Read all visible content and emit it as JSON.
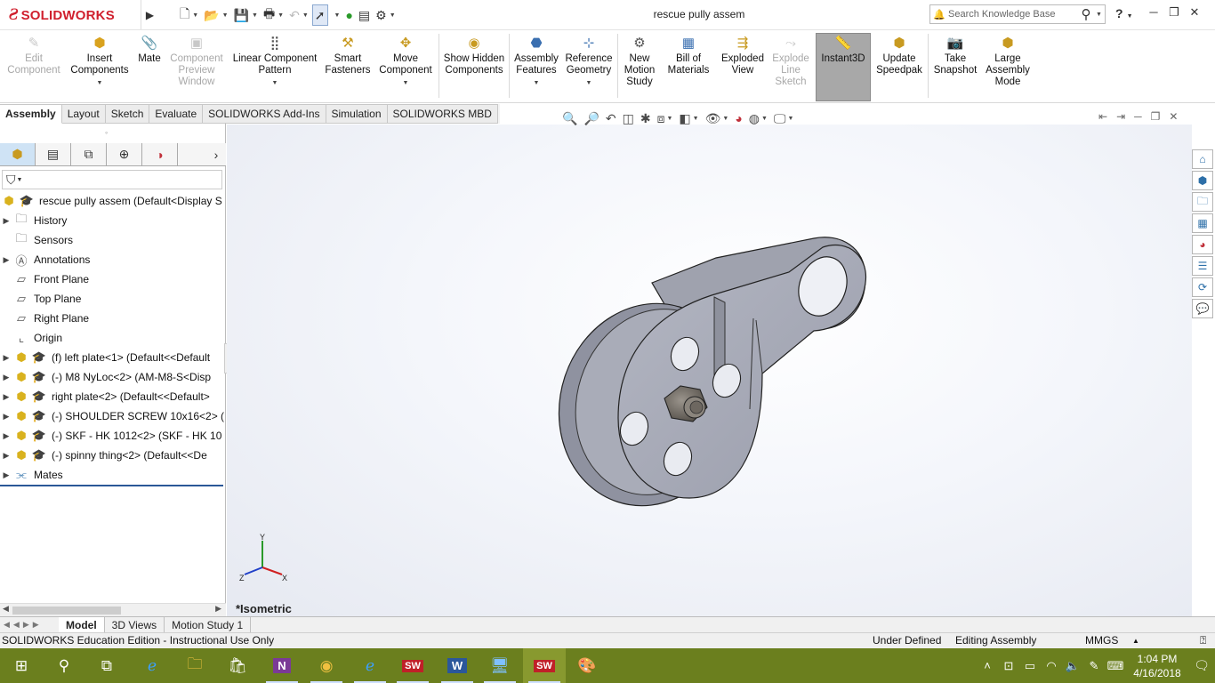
{
  "app": {
    "logo_ds": "Ƨ",
    "logo_text": "SOLIDWORKS",
    "title": "rescue pully assem"
  },
  "search": {
    "placeholder": "Search Knowledge Base"
  },
  "help": {
    "label": "?"
  },
  "ribbon": {
    "edit_component": "Edit Component",
    "insert_components": "Insert Components",
    "mate": "Mate",
    "component_preview_window": "Component Preview Window",
    "linear_component_pattern": "Linear Component Pattern",
    "smart_fasteners": "Smart Fasteners",
    "move_component": "Move Component",
    "show_hidden_components": "Show Hidden Components",
    "assembly_features": "Assembly Features",
    "reference_geometry": "Reference Geometry",
    "new_motion_study": "New Motion Study",
    "bill_of_materials": "Bill of Materials",
    "exploded_view": "Exploded View",
    "explode_line_sketch": "Explode Line Sketch",
    "instant3d": "Instant3D",
    "update_speedpak": "Update Speedpak",
    "take_snapshot": "Take Snapshot",
    "large_assembly_mode": "Large Assembly Mode"
  },
  "command_tabs": [
    "Assembly",
    "Layout",
    "Sketch",
    "Evaluate",
    "SOLIDWORKS Add-Ins",
    "Simulation",
    "SOLIDWORKS MBD"
  ],
  "tree": {
    "root": "rescue pully assem  (Default<Display S",
    "history": "History",
    "sensors": "Sensors",
    "annotations": "Annotations",
    "front_plane": "Front Plane",
    "top_plane": "Top Plane",
    "right_plane": "Right Plane",
    "origin": "Origin",
    "comp1": "(f) left plate<1> (Default<<Default",
    "comp2": "(-) M8 NyLoc<2> (AM-M8-S<Disp",
    "comp3": "right plate<2> (Default<<Default>",
    "comp4": "(-) SHOULDER SCREW 10x16<2> (I",
    "comp5": "(-) SKF - HK 1012<2> (SKF - HK 10",
    "comp6": "(-) spinny thing<2> (Default<<De",
    "mates": "Mates"
  },
  "viewport": {
    "view_name": "*Isometric",
    "triad_x": "X",
    "triad_y": "Y",
    "triad_z": "Z"
  },
  "model_tabs": [
    "Model",
    "3D Views",
    "Motion Study 1"
  ],
  "status": {
    "edition": "SOLIDWORKS Education Edition - Instructional Use Only",
    "definition": "Under Defined",
    "mode": "Editing Assembly",
    "units": "MMGS",
    "units_arrow": "▲"
  },
  "taskbar": {
    "time": "1:04 PM",
    "date": "4/16/2018",
    "onenote": "N",
    "word": "W",
    "sw1": "SW",
    "sw2": "SW"
  },
  "colors": {
    "brand_red": "#d0202e",
    "taskbar": "#6b7f1e",
    "selection_blue": "#2b5797",
    "model_gray": "#a3a6b2"
  }
}
